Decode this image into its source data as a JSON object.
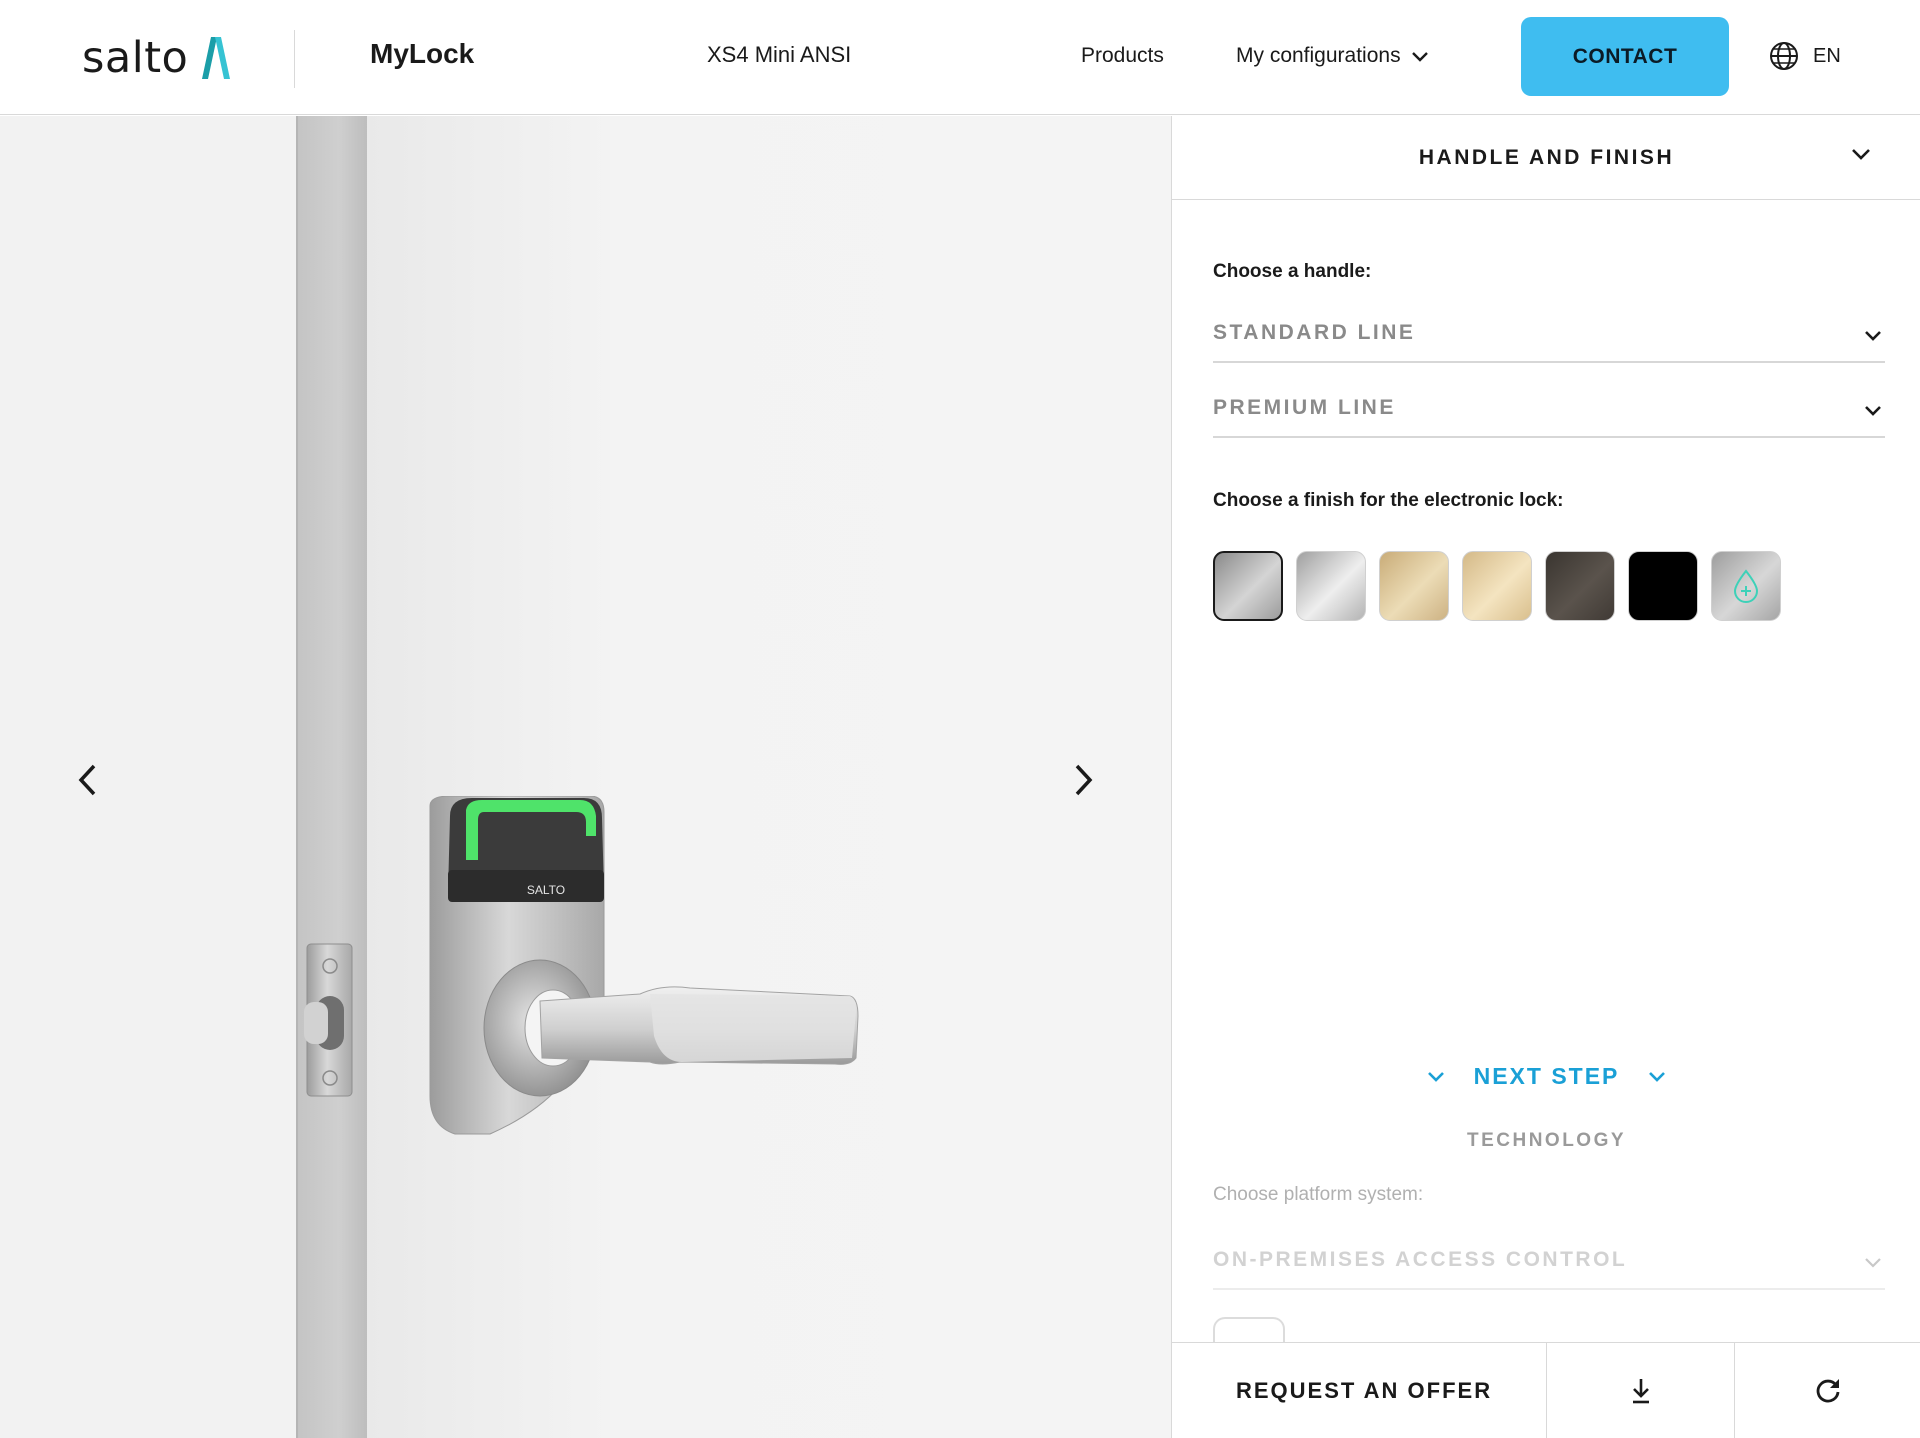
{
  "header": {
    "logo_text": "salto",
    "app_title": "MyLock",
    "product_title": "XS4 Mini ANSI",
    "nav_products": "Products",
    "nav_configurations": "My configurations",
    "contact_label": "CONTACT",
    "language": "EN",
    "accent_color": "#3fbdf0"
  },
  "viewer": {
    "lock_brand_label": "SALTO",
    "prev_icon": "chevron-left-icon",
    "next_icon": "chevron-right-icon"
  },
  "panel": {
    "section_title": "HANDLE AND FINISH",
    "handle_label": "Choose a handle:",
    "handle_options": [
      {
        "label": "STANDARD LINE"
      },
      {
        "label": "PREMIUM LINE"
      }
    ],
    "finish_label": "Choose a finish for the electronic lock:",
    "finishes": [
      {
        "name": "satin-stainless",
        "color": "#a9a9a9",
        "selected": true
      },
      {
        "name": "polished-chrome",
        "color": "#c8c8c8",
        "selected": false
      },
      {
        "name": "satin-brass",
        "color": "#d8bf8e",
        "selected": false
      },
      {
        "name": "polished-brass",
        "color": "#e3cb98",
        "selected": false
      },
      {
        "name": "dark-bronze",
        "color": "#4a4540",
        "selected": false
      },
      {
        "name": "black",
        "color": "#000000",
        "selected": false
      },
      {
        "name": "antimicrobial",
        "color": "#b3b3b3",
        "selected": false,
        "icon": "drop-plus-icon"
      }
    ],
    "next_step_label": "NEXT STEP",
    "next_step_title": "TECHNOLOGY",
    "platform_label": "Choose platform system:",
    "platform_value": "ON-PREMISES ACCESS CONTROL",
    "link_color": "#1aa0d6"
  },
  "bottom_bar": {
    "request_offer": "REQUEST AN OFFER",
    "download_icon": "download-icon",
    "reset_icon": "reset-icon"
  }
}
